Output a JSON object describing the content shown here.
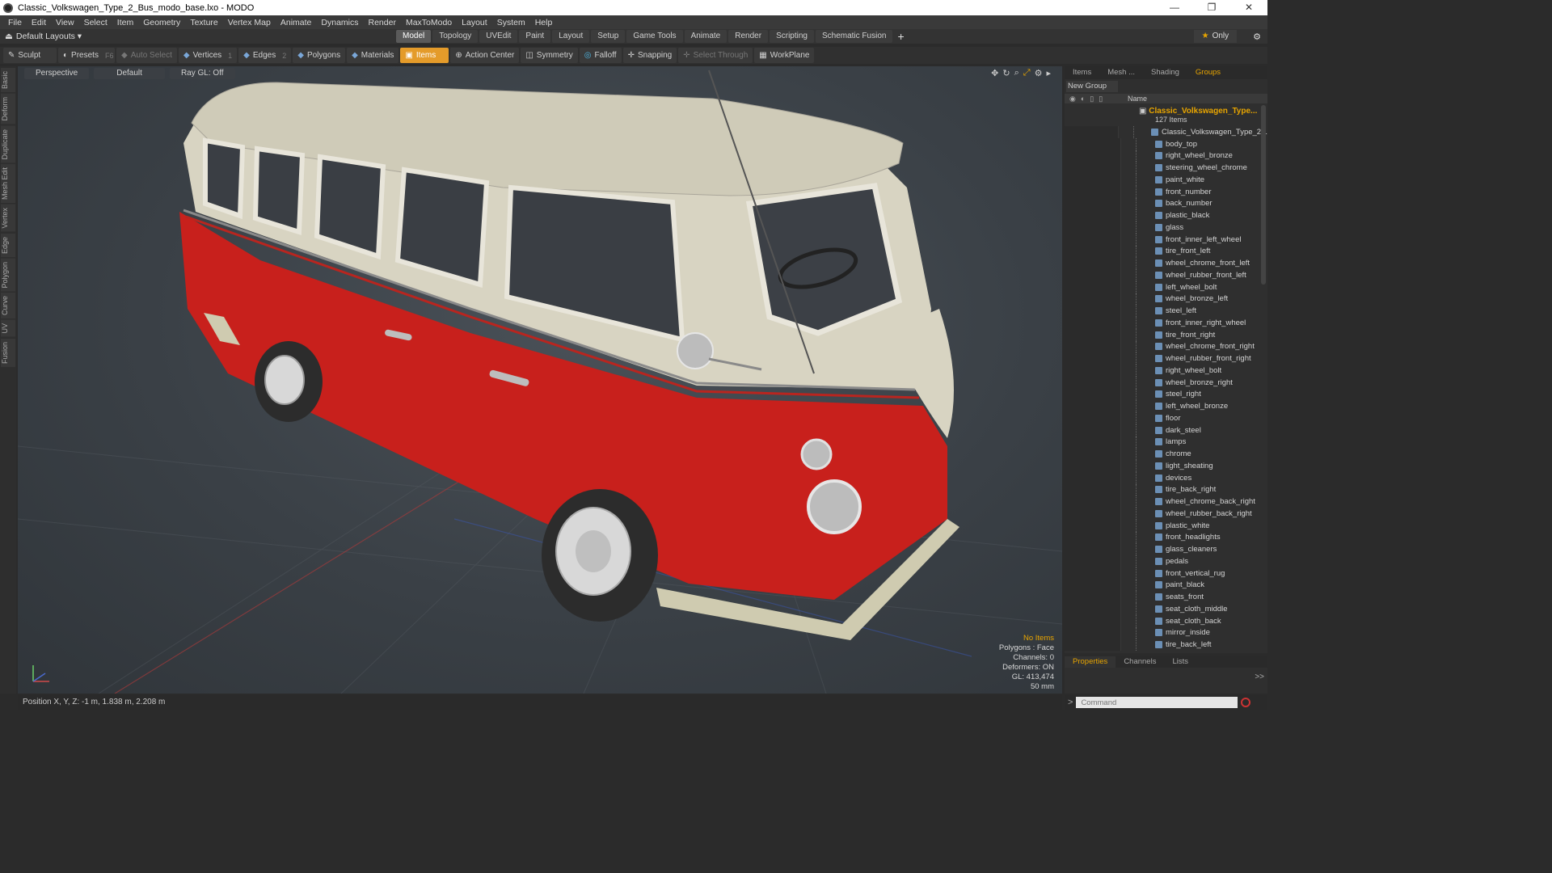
{
  "window": {
    "title": "Classic_Volkswagen_Type_2_Bus_modo_base.lxo - MODO",
    "min": "—",
    "max": "❐",
    "close": "✕"
  },
  "menu": [
    "File",
    "Edit",
    "View",
    "Select",
    "Item",
    "Geometry",
    "Texture",
    "Vertex Map",
    "Animate",
    "Dynamics",
    "Render",
    "MaxToModo",
    "Layout",
    "System",
    "Help"
  ],
  "layout": {
    "selector": "Default Layouts ▾",
    "tabs": [
      "Model",
      "Topology",
      "UVEdit",
      "Paint",
      "Layout",
      "Setup",
      "Game Tools",
      "Animate",
      "Render",
      "Scripting",
      "Schematic Fusion"
    ],
    "active_tab": "Model",
    "only": "Only"
  },
  "toolbar": {
    "sculpt": "Sculpt",
    "presets": "Presets",
    "presets_key": "F6",
    "auto_select": "Auto Select",
    "vertices": "Vertices",
    "vertices_key": "1",
    "edges": "Edges",
    "edges_key": "2",
    "polygons": "Polygons",
    "materials": "Materials",
    "items": "Items",
    "action_center": "Action Center",
    "symmetry": "Symmetry",
    "falloff": "Falloff",
    "snapping": "Snapping",
    "select_through": "Select Through",
    "workplane": "WorkPlane"
  },
  "left_tabs": [
    "Basic",
    "Deform",
    "Duplicate",
    "Mesh Edit",
    "Vertex",
    "Edge",
    "Polygon",
    "Curve",
    "UV",
    "Fusion"
  ],
  "viewport": {
    "view": "Perspective",
    "shading": "Default",
    "raygl": "Ray GL: Off",
    "info": {
      "selection": "No Items",
      "polygons": "Polygons : Face",
      "channels": "Channels: 0",
      "deformers": "Deformers: ON",
      "gl": "GL: 413,474",
      "scale": "50 mm"
    }
  },
  "status": {
    "position": "Position X, Y, Z:  -1 m, 1.838 m, 2.208 m"
  },
  "right_panel": {
    "tabs": [
      "Items",
      "Mesh ...",
      "Shading",
      "Groups"
    ],
    "active_tab": "Groups",
    "new_group": "New Group",
    "column_name": "Name",
    "group_name": "Classic_Volkswagen_Type...",
    "group_count": "127 Items",
    "items": [
      "Classic_Volkswagen_Type_2...",
      "body_top",
      "right_wheel_bronze",
      "steering_wheel_chrome",
      "paint_white",
      "front_number",
      "back_number",
      "plastic_black",
      "glass",
      "front_inner_left_wheel",
      "tire_front_left",
      "wheel_chrome_front_left",
      "wheel_rubber_front_left",
      "left_wheel_bolt",
      "wheel_bronze_left",
      "steel_left",
      "front_inner_right_wheel",
      "tire_front_right",
      "wheel_chrome_front_right",
      "wheel_rubber_front_right",
      "right_wheel_bolt",
      "wheel_bronze_right",
      "steel_right",
      "left_wheel_bronze",
      "floor",
      "dark_steel",
      "lamps",
      "chrome",
      "light_sheating",
      "devices",
      "tire_back_right",
      "wheel_chrome_back_right",
      "wheel_rubber_back_right",
      "plastic_white",
      "front_headlights",
      "glass_cleaners",
      "pedals",
      "front_vertical_rug",
      "paint_black",
      "seats_front",
      "seat_cloth_middle",
      "seat_cloth_back",
      "mirror_inside",
      "tire_back_left"
    ]
  },
  "bottom_panel": {
    "tabs": [
      "Properties",
      "Channels",
      "Lists"
    ],
    "active_tab": "Properties",
    "expand": ">>"
  },
  "command": {
    "placeholder": "Command"
  },
  "colors": {
    "accent": "#e49b2a",
    "bus_red": "#c8201c",
    "bus_cream": "#d8d4c2"
  }
}
